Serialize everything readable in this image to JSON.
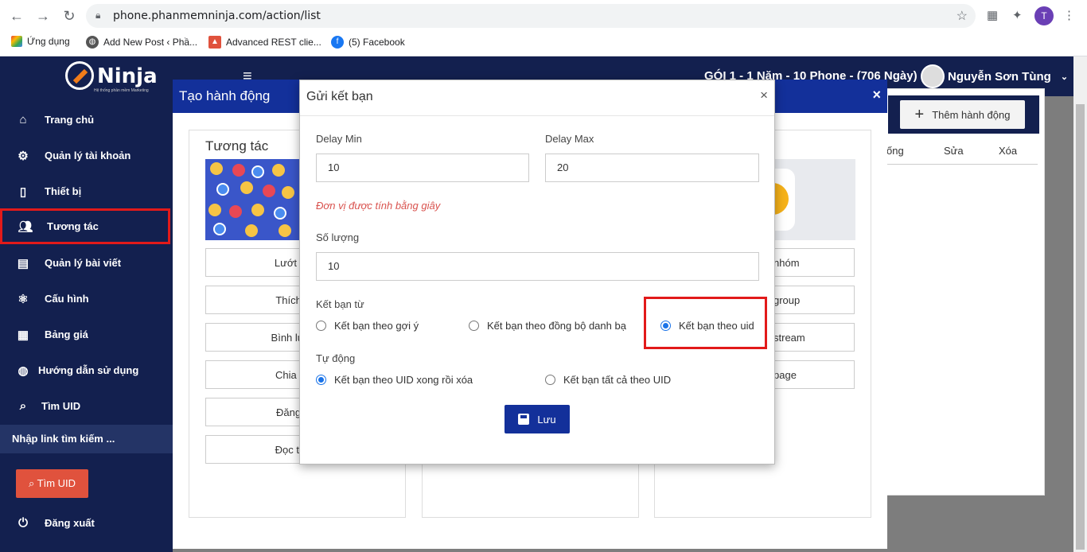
{
  "browser": {
    "url": "phone.phanmemninja.com/action/list",
    "profile_initial": "T",
    "bookmarks": [
      {
        "label": "Ứng dụng",
        "icon": "apps-grid-icon"
      },
      {
        "label": "Add New Post ‹ Phầ...",
        "icon": "globe-icon"
      },
      {
        "label": "Advanced REST clie...",
        "icon": "rest-client-icon"
      },
      {
        "label": "(5) Facebook",
        "icon": "facebook-icon"
      }
    ]
  },
  "app": {
    "logo": "Ninja",
    "logo_tagline": "Hệ thống phần mềm Marketing",
    "plan": "GÓI 1 - 1 Năm - 10 Phone - (706 Ngày)",
    "user_name": "Nguyễn Sơn Tùng",
    "sidebar": [
      {
        "label": "Trang chủ",
        "icon": "home-icon"
      },
      {
        "label": "Quản lý tài khoản",
        "icon": "gear-icon"
      },
      {
        "label": "Thiết bị",
        "icon": "phone-icon"
      },
      {
        "label": "Tương tác",
        "icon": "users-icon"
      },
      {
        "label": "Quản lý bài viết",
        "icon": "book-icon"
      },
      {
        "label": "Cấu hình",
        "icon": "atom-icon"
      },
      {
        "label": "Bảng giá",
        "icon": "calendar-icon"
      },
      {
        "label": "Hướng dẫn sử dụng",
        "icon": "globe-icon"
      },
      {
        "label": "Tìm UID",
        "icon": "search-icon"
      }
    ],
    "sidebar_search_placeholder": "Nhập link tìm kiếm ...",
    "find_uid_button": "Tìm UID",
    "logout": "Đăng xuất",
    "add_action_button": "Thêm hành động",
    "right_columns": [
      "ống",
      "Sửa",
      "Xóa"
    ]
  },
  "create_action_modal": {
    "title": "Tạo hành động",
    "panel_title": "Tương tác",
    "left_actions": [
      "Lướt ne",
      "Thích b",
      "Bình luận",
      "Chia sẻ",
      "Đăng b",
      "Đọc thô"
    ],
    "right_actions": [
      "nhóm",
      "group",
      "stream",
      "page"
    ]
  },
  "dialog": {
    "title": "Gửi kết bạn",
    "delay_min_label": "Delay Min",
    "delay_min_value": "10",
    "delay_max_label": "Delay Max",
    "delay_max_value": "20",
    "unit_note": "Đơn vị được tính bằng giây",
    "quantity_label": "Số lượng",
    "quantity_value": "10",
    "source_label": "Kết bạn từ",
    "source_options": [
      "Kết bạn theo gợi ý",
      "Kết bạn theo đồng bộ danh bạ",
      "Kết bạn theo uid"
    ],
    "source_selected": 2,
    "auto_label": "Tự động",
    "auto_options": [
      "Kết bạn theo UID xong rồi xóa",
      "Kết bạn tất cả theo UID"
    ],
    "auto_selected": 0,
    "save_button": "Lưu"
  }
}
